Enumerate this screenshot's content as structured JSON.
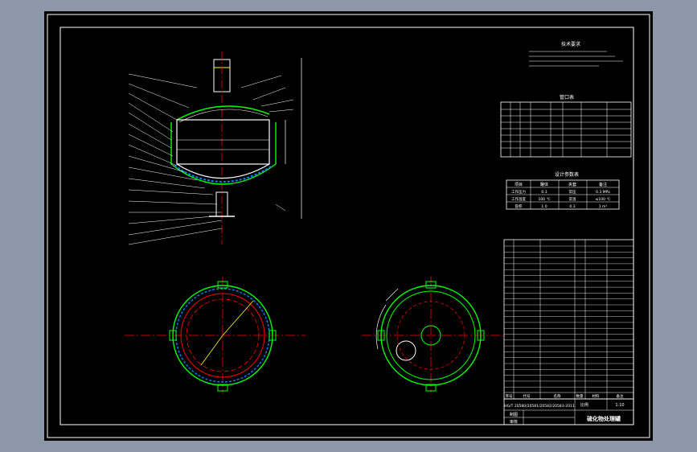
{
  "drawing": {
    "title_block": {
      "drawing_title": "硫化物处理罐",
      "scale_label": "比例",
      "scale_value": "1:10",
      "row_label_1": "制图",
      "row_label_2": "审核",
      "material_label": "材料",
      "weight_label": "重量",
      "sheet_label": "共 张",
      "bottom_left_text": "HG/T 20580/20581/20582/20583-2011"
    },
    "tech_requirements_title": "技术要求",
    "nozzle_table_title": "管口表",
    "design_table_title": "设计参数表",
    "design_table": {
      "header": [
        "项目",
        "罐体",
        "夹套",
        "备注"
      ],
      "rows": [
        [
          "工作压力",
          "0.3",
          "常压",
          "0.3 MPa"
        ],
        [
          "工作温度",
          "100 ℃",
          "常温",
          "≤100 ℃"
        ],
        [
          "容积",
          "1.0",
          "0.3",
          "1 m³"
        ]
      ]
    },
    "parts_list_header": [
      "序号",
      "代号",
      "名称",
      "数量",
      "材料",
      "备注"
    ],
    "colors": {
      "sheet": "#000000",
      "frame": "#ffffff",
      "vessel": "#00ff00",
      "centerline": "#ff0000",
      "dimension": "#ffffff",
      "hatch": "#0080ff",
      "accent": "#ffff00"
    }
  }
}
